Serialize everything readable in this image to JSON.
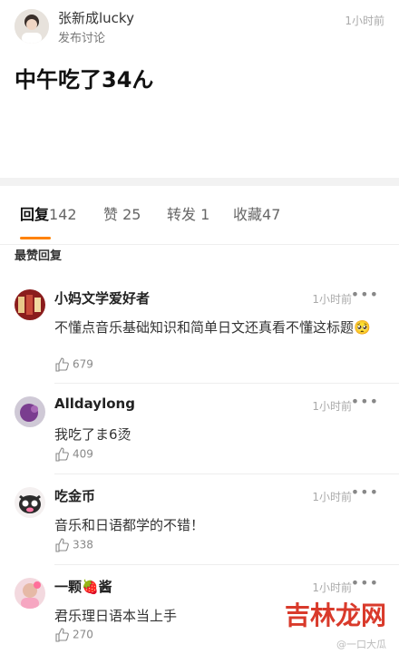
{
  "post": {
    "author": "张新成lucky",
    "subtitle": "发布讨论",
    "time": "1小时前",
    "text": "中午吃了34ん"
  },
  "tabs": {
    "reply": {
      "label": "回复",
      "count": "142"
    },
    "like": {
      "label": "赞",
      "count": "25"
    },
    "repost": {
      "label": "转发",
      "count": "1"
    },
    "favorite": {
      "label": "收藏",
      "count": "47"
    }
  },
  "section_title": "最赞回复",
  "comments": [
    {
      "name": "小妈文学爱好者",
      "time": "1小时前",
      "text": "不懂点音乐基础知识和简单日文还真看不懂这标题🥺",
      "likes": "679"
    },
    {
      "name": "Alldaylong",
      "time": "1小时前",
      "text": "我吃了ま6烫",
      "likes": "409"
    },
    {
      "name": "吃金币",
      "time": "1小时前",
      "text": "音乐和日语都学的不错！",
      "likes": "338"
    },
    {
      "name": "一颗🍓酱",
      "time": "1小时前",
      "text": "君乐理日语本当上手",
      "likes": "270"
    }
  ],
  "more_label": "•••",
  "watermark": {
    "main": "吉林龙网",
    "small": "@一口大瓜"
  },
  "colors": {
    "accent": "#ff8200",
    "watermark": "#d93a2b"
  }
}
